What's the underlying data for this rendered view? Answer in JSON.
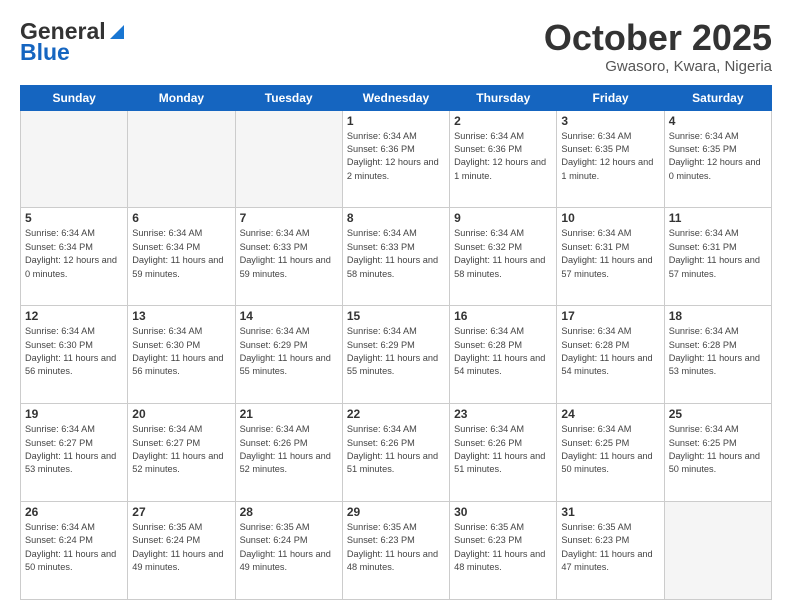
{
  "header": {
    "logo_general": "General",
    "logo_blue": "Blue",
    "month": "October 2025",
    "location": "Gwasoro, Kwara, Nigeria"
  },
  "days_of_week": [
    "Sunday",
    "Monday",
    "Tuesday",
    "Wednesday",
    "Thursday",
    "Friday",
    "Saturday"
  ],
  "weeks": [
    [
      {
        "day": "",
        "info": ""
      },
      {
        "day": "",
        "info": ""
      },
      {
        "day": "",
        "info": ""
      },
      {
        "day": "1",
        "info": "Sunrise: 6:34 AM\nSunset: 6:36 PM\nDaylight: 12 hours\nand 2 minutes."
      },
      {
        "day": "2",
        "info": "Sunrise: 6:34 AM\nSunset: 6:36 PM\nDaylight: 12 hours\nand 1 minute."
      },
      {
        "day": "3",
        "info": "Sunrise: 6:34 AM\nSunset: 6:35 PM\nDaylight: 12 hours\nand 1 minute."
      },
      {
        "day": "4",
        "info": "Sunrise: 6:34 AM\nSunset: 6:35 PM\nDaylight: 12 hours\nand 0 minutes."
      }
    ],
    [
      {
        "day": "5",
        "info": "Sunrise: 6:34 AM\nSunset: 6:34 PM\nDaylight: 12 hours\nand 0 minutes."
      },
      {
        "day": "6",
        "info": "Sunrise: 6:34 AM\nSunset: 6:34 PM\nDaylight: 11 hours\nand 59 minutes."
      },
      {
        "day": "7",
        "info": "Sunrise: 6:34 AM\nSunset: 6:33 PM\nDaylight: 11 hours\nand 59 minutes."
      },
      {
        "day": "8",
        "info": "Sunrise: 6:34 AM\nSunset: 6:33 PM\nDaylight: 11 hours\nand 58 minutes."
      },
      {
        "day": "9",
        "info": "Sunrise: 6:34 AM\nSunset: 6:32 PM\nDaylight: 11 hours\nand 58 minutes."
      },
      {
        "day": "10",
        "info": "Sunrise: 6:34 AM\nSunset: 6:31 PM\nDaylight: 11 hours\nand 57 minutes."
      },
      {
        "day": "11",
        "info": "Sunrise: 6:34 AM\nSunset: 6:31 PM\nDaylight: 11 hours\nand 57 minutes."
      }
    ],
    [
      {
        "day": "12",
        "info": "Sunrise: 6:34 AM\nSunset: 6:30 PM\nDaylight: 11 hours\nand 56 minutes."
      },
      {
        "day": "13",
        "info": "Sunrise: 6:34 AM\nSunset: 6:30 PM\nDaylight: 11 hours\nand 56 minutes."
      },
      {
        "day": "14",
        "info": "Sunrise: 6:34 AM\nSunset: 6:29 PM\nDaylight: 11 hours\nand 55 minutes."
      },
      {
        "day": "15",
        "info": "Sunrise: 6:34 AM\nSunset: 6:29 PM\nDaylight: 11 hours\nand 55 minutes."
      },
      {
        "day": "16",
        "info": "Sunrise: 6:34 AM\nSunset: 6:28 PM\nDaylight: 11 hours\nand 54 minutes."
      },
      {
        "day": "17",
        "info": "Sunrise: 6:34 AM\nSunset: 6:28 PM\nDaylight: 11 hours\nand 54 minutes."
      },
      {
        "day": "18",
        "info": "Sunrise: 6:34 AM\nSunset: 6:28 PM\nDaylight: 11 hours\nand 53 minutes."
      }
    ],
    [
      {
        "day": "19",
        "info": "Sunrise: 6:34 AM\nSunset: 6:27 PM\nDaylight: 11 hours\nand 53 minutes."
      },
      {
        "day": "20",
        "info": "Sunrise: 6:34 AM\nSunset: 6:27 PM\nDaylight: 11 hours\nand 52 minutes."
      },
      {
        "day": "21",
        "info": "Sunrise: 6:34 AM\nSunset: 6:26 PM\nDaylight: 11 hours\nand 52 minutes."
      },
      {
        "day": "22",
        "info": "Sunrise: 6:34 AM\nSunset: 6:26 PM\nDaylight: 11 hours\nand 51 minutes."
      },
      {
        "day": "23",
        "info": "Sunrise: 6:34 AM\nSunset: 6:26 PM\nDaylight: 11 hours\nand 51 minutes."
      },
      {
        "day": "24",
        "info": "Sunrise: 6:34 AM\nSunset: 6:25 PM\nDaylight: 11 hours\nand 50 minutes."
      },
      {
        "day": "25",
        "info": "Sunrise: 6:34 AM\nSunset: 6:25 PM\nDaylight: 11 hours\nand 50 minutes."
      }
    ],
    [
      {
        "day": "26",
        "info": "Sunrise: 6:34 AM\nSunset: 6:24 PM\nDaylight: 11 hours\nand 50 minutes."
      },
      {
        "day": "27",
        "info": "Sunrise: 6:35 AM\nSunset: 6:24 PM\nDaylight: 11 hours\nand 49 minutes."
      },
      {
        "day": "28",
        "info": "Sunrise: 6:35 AM\nSunset: 6:24 PM\nDaylight: 11 hours\nand 49 minutes."
      },
      {
        "day": "29",
        "info": "Sunrise: 6:35 AM\nSunset: 6:23 PM\nDaylight: 11 hours\nand 48 minutes."
      },
      {
        "day": "30",
        "info": "Sunrise: 6:35 AM\nSunset: 6:23 PM\nDaylight: 11 hours\nand 48 minutes."
      },
      {
        "day": "31",
        "info": "Sunrise: 6:35 AM\nSunset: 6:23 PM\nDaylight: 11 hours\nand 47 minutes."
      },
      {
        "day": "",
        "info": ""
      }
    ]
  ]
}
